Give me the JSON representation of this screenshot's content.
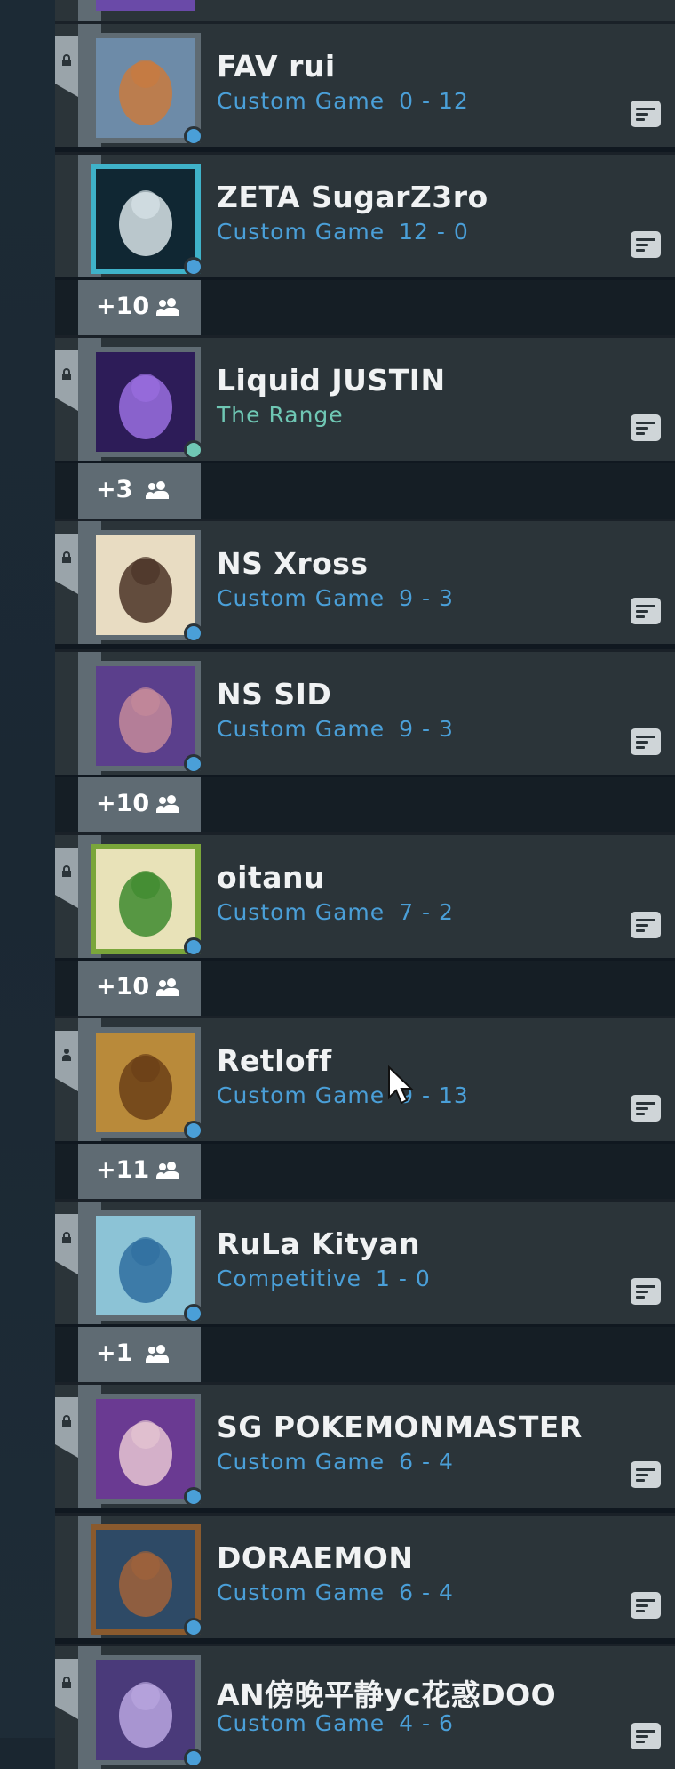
{
  "players": [
    {
      "name": "FAV rui",
      "mode": "Custom Game",
      "score": "0 - 12",
      "mode_color": "#4a9fd8",
      "rail_icon": "lock-icon",
      "avatar_icon": "fox-avatar",
      "avatar_bg": "#6d8ba8",
      "avatar_accent": "#c97a3e",
      "dot_color": "#4a9fd8",
      "frame": "#5f6b73"
    },
    {
      "name": "ZETA SugarZ3ro",
      "mode": "Custom Game",
      "score": "12 - 0",
      "mode_color": "#4a9fd8",
      "rail_icon": "none",
      "avatar_icon": "zeta-logo-avatar",
      "avatar_bg": "#102733",
      "avatar_accent": "#d8e4e8",
      "dot_color": "#4a9fd8",
      "frame": "#3fb2c9"
    },
    {
      "name": "Liquid JUSTIN",
      "mode": "The Range",
      "score": "",
      "mode_color": "#6fc7b4",
      "rail_icon": "lock-icon",
      "avatar_icon": "crystal-avatar",
      "avatar_bg": "#2d1c58",
      "avatar_accent": "#9a6ee0",
      "dot_color": "#6fc7b4",
      "frame": "#5f6b73"
    },
    {
      "name": "NS Xross",
      "mode": "Custom Game",
      "score": "9 - 3",
      "mode_color": "#4a9fd8",
      "rail_icon": "lock-icon",
      "avatar_icon": "ornate-avatar",
      "avatar_bg": "#e8dcc2",
      "avatar_accent": "#4a3326",
      "dot_color": "#4a9fd8",
      "frame": "#5f6b73"
    },
    {
      "name": "NS SID",
      "mode": "Custom Game",
      "score": "9 - 3",
      "mode_color": "#4a9fd8",
      "rail_icon": "none",
      "avatar_icon": "hooded-girl-avatar",
      "avatar_bg": "#5b3f8c",
      "avatar_accent": "#c48a9a",
      "dot_color": "#4a9fd8",
      "frame": "#5f6b73"
    },
    {
      "name": "oitanu",
      "mode": "Custom Game",
      "score": "7 - 2",
      "mode_color": "#4a9fd8",
      "rail_icon": "lock-icon",
      "avatar_icon": "sprout-avatar",
      "avatar_bg": "#e8e2b8",
      "avatar_accent": "#3d8a2e",
      "dot_color": "#4a9fd8",
      "frame": "#7aa63a"
    },
    {
      "name": "Retloff",
      "mode": "Custom Game",
      "score": "9 - 13",
      "mode_color": "#4a9fd8",
      "rail_icon": "person-icon",
      "avatar_icon": "golden-hero-avatar",
      "avatar_bg": "#b98a3a",
      "avatar_accent": "#6b3f17",
      "dot_color": "#4a9fd8",
      "frame": "#5f6b73"
    },
    {
      "name": "RuLa Kityan",
      "mode": "Competitive",
      "score": "1 - 0",
      "mode_color": "#4a9fd8",
      "rail_icon": "lock-icon",
      "avatar_icon": "bird-avatar",
      "avatar_bg": "#8cc3d6",
      "avatar_accent": "#2f6fa0",
      "dot_color": "#4a9fd8",
      "frame": "#5f6b73"
    },
    {
      "name": "SG POKEMONMASTER",
      "mode": "Custom Game",
      "score": "6 - 4",
      "mode_color": "#4a9fd8",
      "rail_icon": "lock-icon",
      "avatar_icon": "purple-character-avatar",
      "avatar_bg": "#6a3a92",
      "avatar_accent": "#e6c6d2",
      "dot_color": "#4a9fd8",
      "frame": "#5f6b73"
    },
    {
      "name": "DORAEMON",
      "mode": "Custom Game",
      "score": "6 - 4",
      "mode_color": "#4a9fd8",
      "rail_icon": "none",
      "avatar_icon": "dark-figure-avatar",
      "avatar_bg": "#2e4a66",
      "avatar_accent": "#a0623a",
      "dot_color": "#4a9fd8",
      "frame": "#8a5a2e"
    },
    {
      "name": "AN傍晚平静yc花惑DOO",
      "mode": "Custom Game",
      "score": "4 - 6",
      "mode_color": "#4a9fd8",
      "rail_icon": "lock-icon",
      "avatar_icon": "purple-flower-avatar",
      "avatar_bg": "#4a3a7a",
      "avatar_accent": "#b9a6e0",
      "dot_color": "#4a9fd8",
      "frame": "#5f6b73"
    }
  ],
  "groups": [
    {
      "count": "+10"
    },
    {
      "count": "+3"
    },
    {
      "count": "+10"
    },
    {
      "count": "+10"
    },
    {
      "count": "+11"
    },
    {
      "count": "+1"
    }
  ],
  "icons": {
    "note": "note-icon",
    "group": "party-members-icon",
    "cursor": "mouse-cursor"
  }
}
